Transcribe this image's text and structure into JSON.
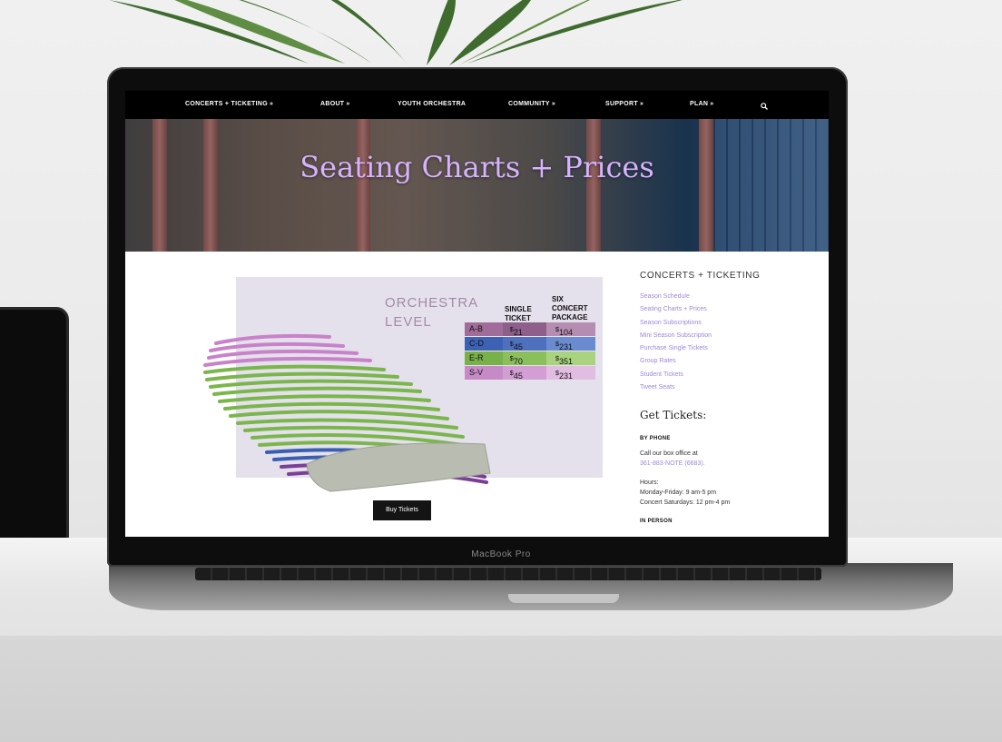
{
  "nav": {
    "items": [
      {
        "label": "CONCERTS + TICKETING",
        "has_dropdown": true
      },
      {
        "label": "ABOUT",
        "has_dropdown": true
      },
      {
        "label": "YOUTH ORCHESTRA",
        "has_dropdown": false
      },
      {
        "label": "COMMUNITY",
        "has_dropdown": true
      },
      {
        "label": "SUPPORT",
        "has_dropdown": true
      },
      {
        "label": "PLAN",
        "has_dropdown": true
      }
    ],
    "search_icon": "search-icon",
    "dropdown_icon": "chevron-down-icon"
  },
  "hero": {
    "title": "Seating Charts + Prices"
  },
  "seating_chart": {
    "level": [
      "ORCHESTRA",
      "LEVEL"
    ],
    "price_headers": {
      "single": [
        "SINGLE",
        "TICKET"
      ],
      "package": [
        "SIX",
        "CONCERT",
        "PACKAGE"
      ]
    },
    "rows": [
      {
        "rows": "A-B",
        "single": "21",
        "package": "104",
        "color": "#9c6b97"
      },
      {
        "rows": "C-D",
        "single": "45",
        "package": "231",
        "color": "#3b63b5"
      },
      {
        "rows": "E-R",
        "single": "70",
        "package": "351",
        "color": "#78b14a"
      },
      {
        "rows": "S-V",
        "single": "45",
        "package": "231",
        "color": "#c389c7"
      }
    ],
    "currency_symbol": "$",
    "colors": {
      "background": "#e4e1ec",
      "stage": "#b9bcb0",
      "pink": "#c882c9",
      "green": "#7bb64c",
      "blue": "#3b5fb0",
      "purple": "#7b3f96"
    }
  },
  "buy_button": {
    "label": "Buy Tickets"
  },
  "sidebar": {
    "heading": "CONCERTS + TICKETING",
    "links": [
      "Season Schedule",
      "Seating Charts + Prices",
      "Season Subscriptions",
      "Mini Season Subscription",
      "Purchase Single Tickets",
      "Group Rates",
      "Student Tickets",
      "Tweet Seats"
    ],
    "get_tickets": {
      "title": "Get Tickets:",
      "by_phone_label": "BY PHONE",
      "call_text": "Call our box office at",
      "phone": "361-883-NOTE (6683).",
      "hours_label": "Hours:",
      "hours_weekday": "Monday-Friday: 9 am-5 pm",
      "hours_concert": "Concert Saturdays: 12 pm-4 pm",
      "in_person_label": "IN PERSON"
    }
  },
  "device": {
    "model": "MacBook Pro"
  },
  "colors": {
    "accent": "#9d88d9",
    "hero_title": "#d7b3ff",
    "nav_bg": "#000000"
  }
}
